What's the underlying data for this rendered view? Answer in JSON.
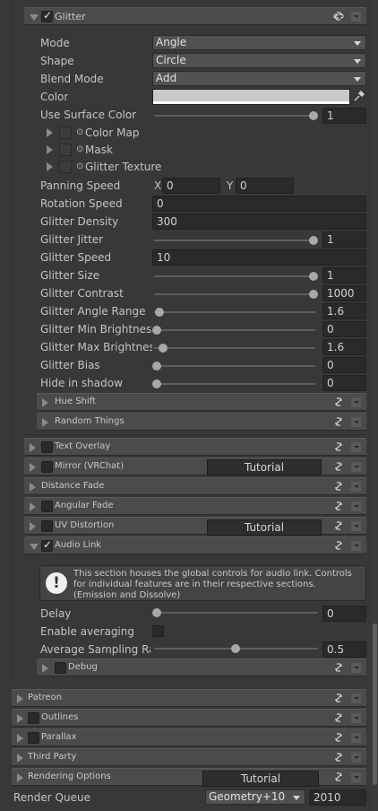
{
  "glitter": {
    "title": "Glitter",
    "checked": true
  },
  "props": {
    "mode": {
      "label": "Mode",
      "value": "Angle"
    },
    "shape": {
      "label": "Shape",
      "value": "Circle"
    },
    "blend_mode": {
      "label": "Blend Mode",
      "value": "Add"
    },
    "color": {
      "label": "Color",
      "value": "#ffffff"
    },
    "use_surface_color": {
      "label": "Use Surface Color",
      "value": "1",
      "fraction": 1.0
    },
    "color_map": {
      "label": "Color Map"
    },
    "mask": {
      "label": "Mask"
    },
    "glitter_texture": {
      "label": "Glitter Texture"
    },
    "panning_speed": {
      "label": "Panning Speed",
      "x_label": "X",
      "x": "0",
      "y_label": "Y",
      "y": "0"
    },
    "rotation_speed": {
      "label": "Rotation Speed",
      "value": "0"
    },
    "glitter_density": {
      "label": "Glitter Density",
      "value": "300"
    },
    "glitter_jitter": {
      "label": "Glitter Jitter",
      "value": "1",
      "fraction": 1.0
    },
    "glitter_speed": {
      "label": "Glitter Speed",
      "value": "10"
    },
    "glitter_size": {
      "label": "Glitter Size",
      "value": "1",
      "fraction": 1.0
    },
    "glitter_contrast": {
      "label": "Glitter Contrast",
      "value": "1000",
      "fraction": 1.0
    },
    "glitter_angle_range": {
      "label": "Glitter Angle Range",
      "value": "1.6",
      "fraction": 0.03
    },
    "glitter_min_brightness": {
      "label": "Glitter Min Brightness",
      "value": "0",
      "fraction": 0.0
    },
    "glitter_max_brightness": {
      "label": "Glitter Max Brightness",
      "value": "1.6",
      "fraction": 0.03
    },
    "glitter_bias": {
      "label": "Glitter Bias",
      "value": "0",
      "fraction": 0.0
    },
    "hide_in_shadow": {
      "label": "Hide in shadow",
      "value": "0",
      "fraction": 0.0
    }
  },
  "sub_sections": {
    "hue_shift": "Hue Shift",
    "random_things": "Random Things"
  },
  "sections": {
    "text_overlay": "Text Overlay",
    "mirror": "Mirror (VRChat)",
    "distance_fade": "Distance Fade",
    "angular_fade": "Angular Fade",
    "uv_distortion": "UV Distortion",
    "audio_link": "Audio Link",
    "tutorial": "Tutorial"
  },
  "audio_link": {
    "info": "This section houses the global controls for audio link. Controls for individual features are in their respective sections. (Emission and Dissolve)",
    "delay": {
      "label": "Delay",
      "value": "0",
      "fraction": 0.0
    },
    "enable_averaging": {
      "label": "Enable averaging",
      "checked": false
    },
    "average_sampling": {
      "label": "Average Sampling Rai",
      "value": "0.5",
      "fraction": 0.5
    },
    "debug": "Debug"
  },
  "bottom_sections": {
    "patreon": "Patreon",
    "outlines": "Outlines",
    "parallax": "Parallax",
    "third_party": "Third Party",
    "rendering_options": "Rendering Options"
  },
  "render_queue": {
    "label": "Render Queue",
    "dropdown": "Geometry+10",
    "value": "2010"
  },
  "icons": {
    "link": "link-icon",
    "menu": "section-menu-icon",
    "eyedropper": "eyedropper-icon",
    "info": "exclamation-icon"
  }
}
